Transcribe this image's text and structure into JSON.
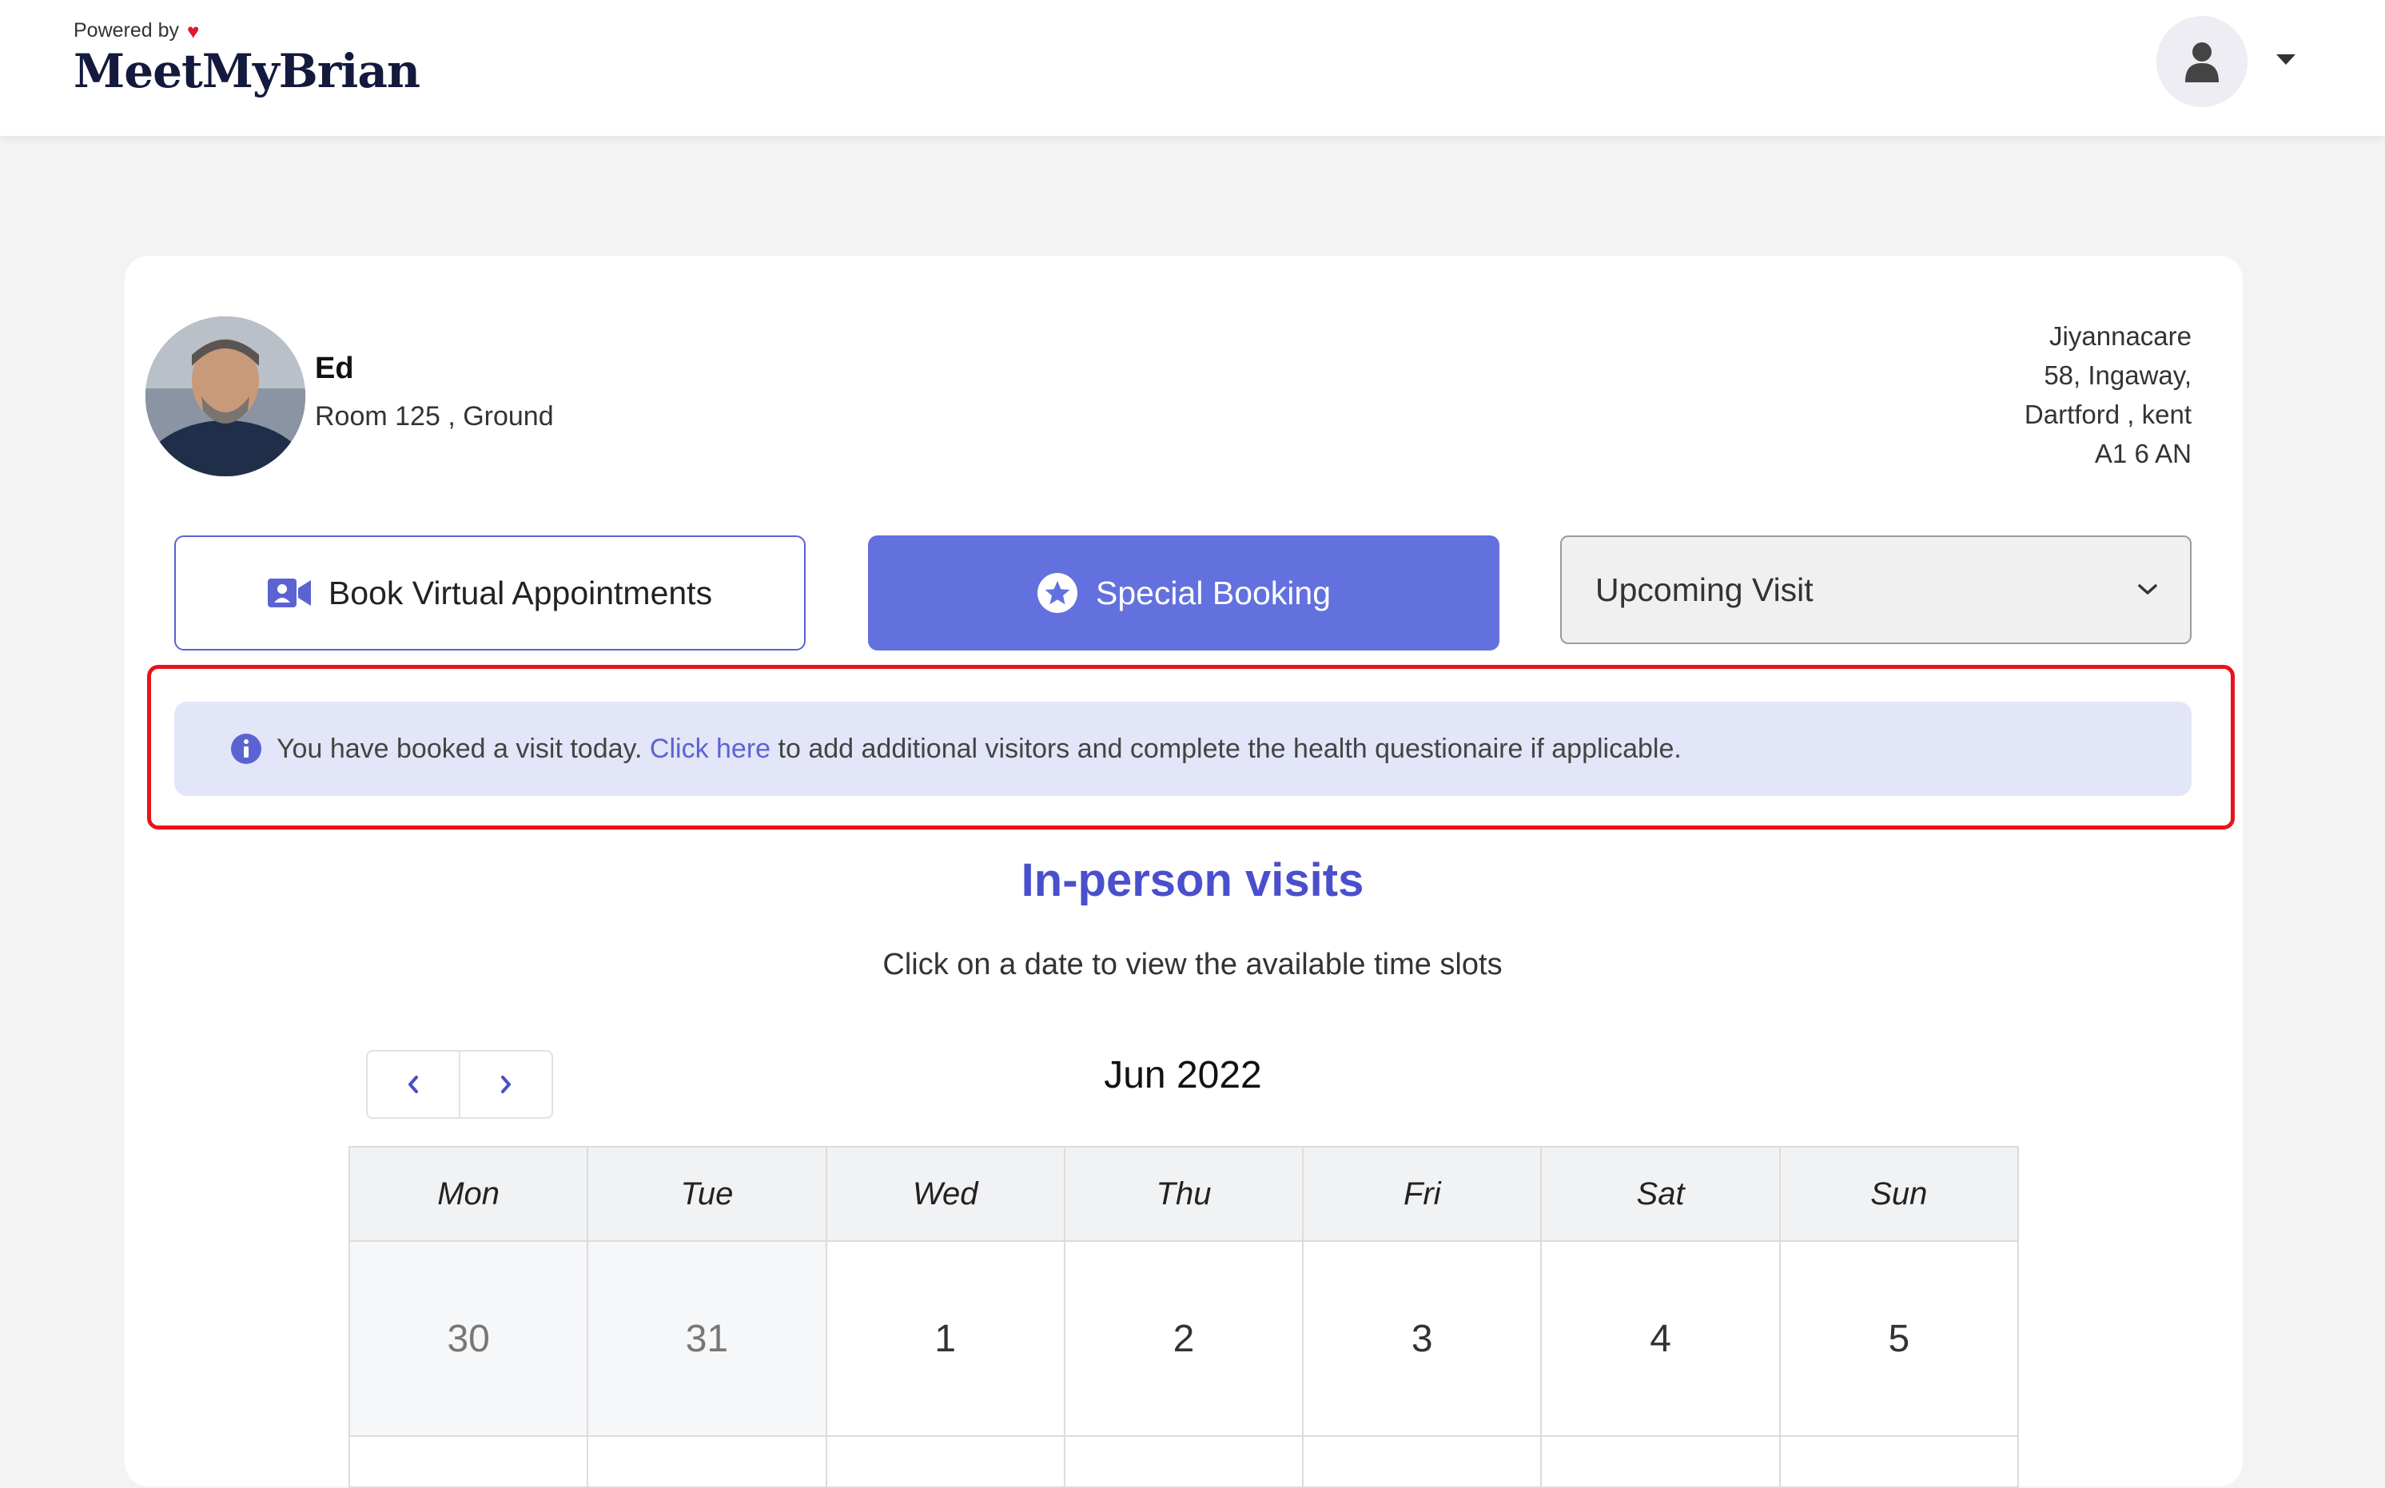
{
  "header": {
    "powered_by": "Powered by",
    "brand": "MeetMyBrian",
    "heart_icon": "heart-icon",
    "user_icon": "user-icon"
  },
  "resident": {
    "name": "Ed",
    "room": "Room 125 , Ground",
    "address_lines": [
      "Jiyannacare",
      "58, Ingaway,",
      "Dartford , kent",
      "A1 6 AN"
    ]
  },
  "actions": {
    "virtual_label": "Book Virtual Appointments",
    "special_label": "Special Booking",
    "upcoming_label": "Upcoming Visit"
  },
  "alert": {
    "text_before": "You have booked a visit today.",
    "link_text": "Click here",
    "text_after": "to add additional visitors and complete the health questionaire if applicable."
  },
  "visits": {
    "title": "In-person visits",
    "subtitle": "Click on a date to view the available time slots"
  },
  "calendar": {
    "month": "Jun 2022",
    "weekdays": [
      "Mon",
      "Tue",
      "Wed",
      "Thu",
      "Fri",
      "Sat",
      "Sun"
    ],
    "week1": [
      "30",
      "31",
      "1",
      "2",
      "3",
      "4",
      "5"
    ]
  },
  "colors": {
    "accent": "#6371df",
    "highlight": "#e8141b",
    "alert_bg": "#e3e5f8"
  }
}
